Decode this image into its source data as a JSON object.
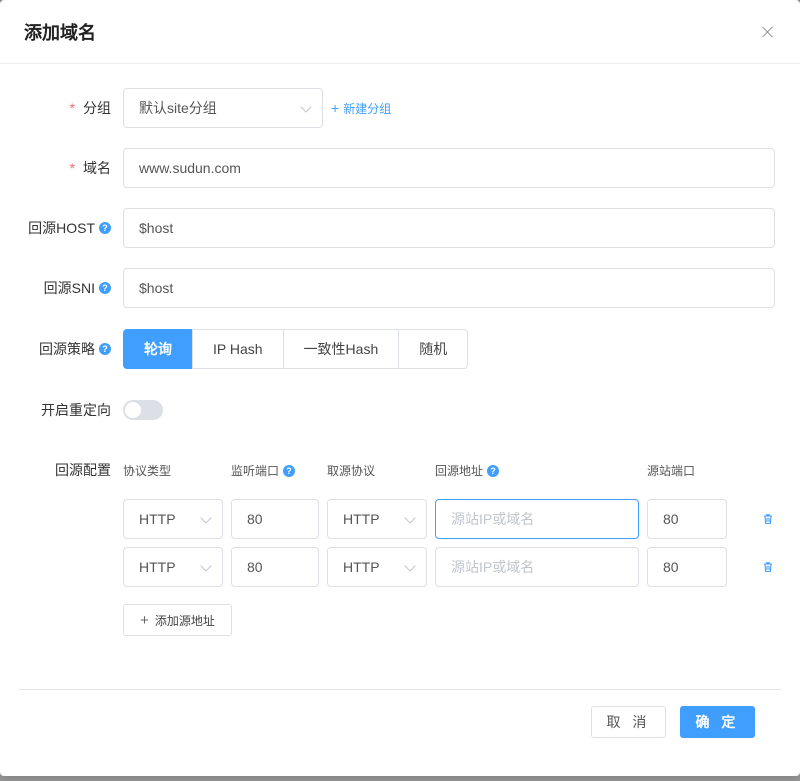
{
  "dialog": {
    "title": "添加域名",
    "close_label": ""
  },
  "form": {
    "group": {
      "label": "分组",
      "value": "默认site分组",
      "new_link": "新建分组"
    },
    "domain": {
      "label": "域名",
      "value": "www.sudun.com"
    },
    "origin_host": {
      "label": "回源HOST",
      "value": "$host"
    },
    "origin_sni": {
      "label": "回源SNI",
      "value": "$host"
    },
    "strategy": {
      "label": "回源策略",
      "options": [
        "轮询",
        "IP Hash",
        "一致性Hash",
        "随机"
      ],
      "selected": "轮询"
    },
    "redirect": {
      "label": "开启重定向",
      "on": false
    }
  },
  "origin_config": {
    "label": "回源配置",
    "columns": {
      "protocol": "协议类型",
      "listen_port": "监听端口",
      "fetch_protocol": "取源协议",
      "origin_address": "回源地址",
      "origin_port": "源站端口"
    },
    "rows": [
      {
        "protocol": "HTTP",
        "listen_port": "80",
        "fetch_protocol": "HTTP",
        "address_placeholder": "源站IP或域名",
        "origin_port": "80"
      },
      {
        "protocol": "HTTP",
        "listen_port": "80",
        "fetch_protocol": "HTTP",
        "address_placeholder": "源站IP或域名",
        "origin_port": "80"
      }
    ],
    "add_label": "添加源地址"
  },
  "footer": {
    "cancel": "取 消",
    "ok": "确 定"
  },
  "colors": {
    "primary": "#409eff",
    "required": "#f56c6c"
  }
}
